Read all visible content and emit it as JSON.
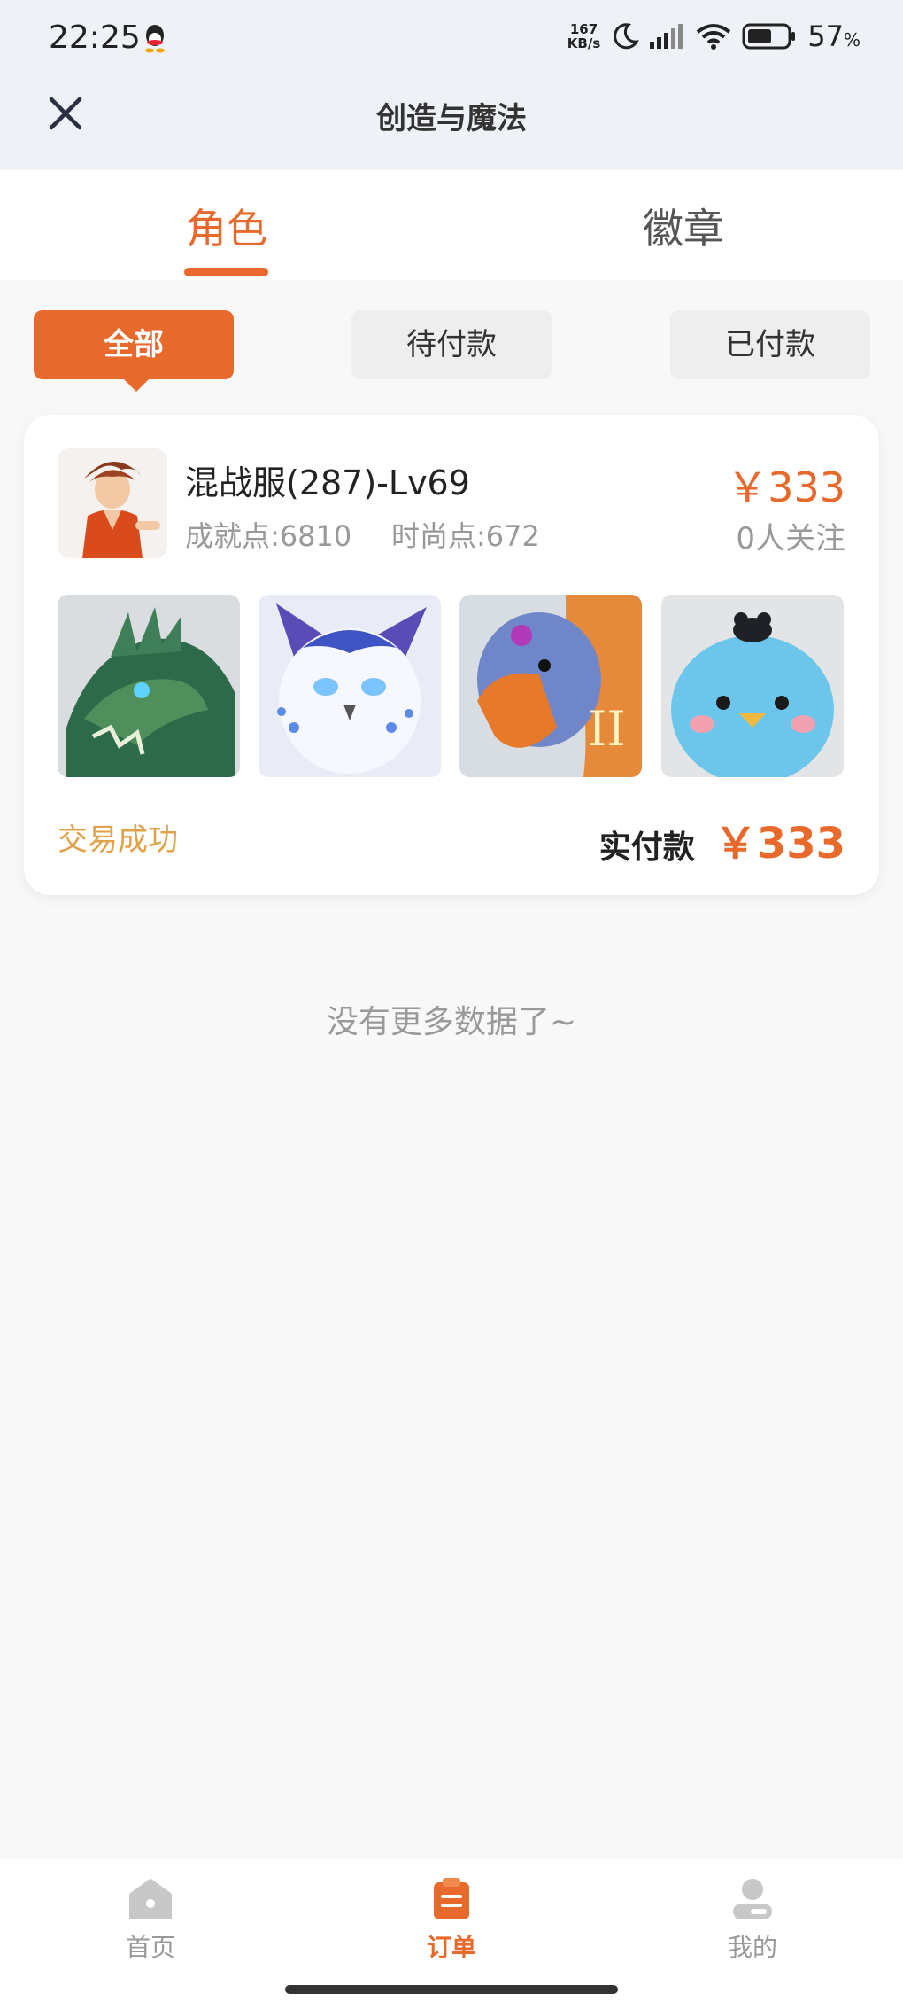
{
  "status_bar": {
    "time": "22:25",
    "net_speed_value": "167",
    "net_speed_unit": "KB/s",
    "battery_percent": "57",
    "battery_unit": "%"
  },
  "header": {
    "title": "创造与魔法"
  },
  "tabs": [
    {
      "label": "角色",
      "active": true
    },
    {
      "label": "徽章",
      "active": false
    }
  ],
  "filters": [
    {
      "label": "全部",
      "active": true
    },
    {
      "label": "待付款",
      "active": false
    },
    {
      "label": "已付款",
      "active": false
    }
  ],
  "order": {
    "server": "混战服(287)-Lv69",
    "achievement": "成就点:6810",
    "fashion": "时尚点:672",
    "price": "￥333",
    "followers": "0人关注",
    "pets": [
      "dragon",
      "white-owl",
      "eagle",
      "blue-bird"
    ],
    "status": "交易成功",
    "paid_label": "实付款",
    "paid_amount": "￥333"
  },
  "no_more_text": "没有更多数据了~",
  "bottom_nav": [
    {
      "label": "首页",
      "icon": "home-icon",
      "active": false
    },
    {
      "label": "订单",
      "icon": "orders-icon",
      "active": true
    },
    {
      "label": "我的",
      "icon": "profile-icon",
      "active": false
    }
  ],
  "colors": {
    "accent": "#e8692c",
    "status_success": "#e0a24a",
    "header_bg": "#eef2f7"
  }
}
